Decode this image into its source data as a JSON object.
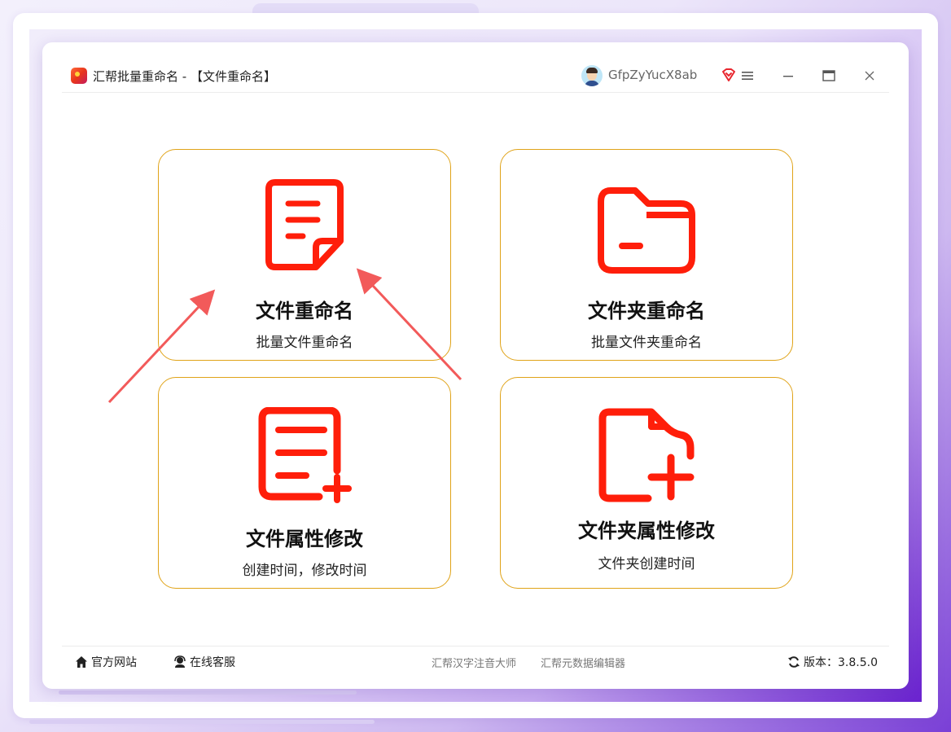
{
  "window": {
    "title": "汇帮批量重命名 - 【文件重命名】",
    "username": "GfpZyYucX8ab"
  },
  "cards": [
    {
      "title": "文件重命名",
      "subtitle": "批量文件重命名",
      "icon": "document-icon"
    },
    {
      "title": "文件夹重命名",
      "subtitle": "批量文件夹重命名",
      "icon": "folder-icon"
    },
    {
      "title": "文件属性修改",
      "subtitle": "创建时间，修改时间",
      "icon": "document-plus-icon"
    },
    {
      "title": "文件夹属性修改",
      "subtitle": "文件夹创建时间",
      "icon": "folder-plus-icon"
    }
  ],
  "footer": {
    "website": "官方网站",
    "support": "在线客服",
    "links": [
      "汇帮汉字注音大师",
      "汇帮元数据编辑器"
    ],
    "version": "版本：3.8.5.0"
  },
  "colors": {
    "accent": "#ff1e0a",
    "card_border": "#e0a318",
    "arrow": "#f25a5a"
  }
}
